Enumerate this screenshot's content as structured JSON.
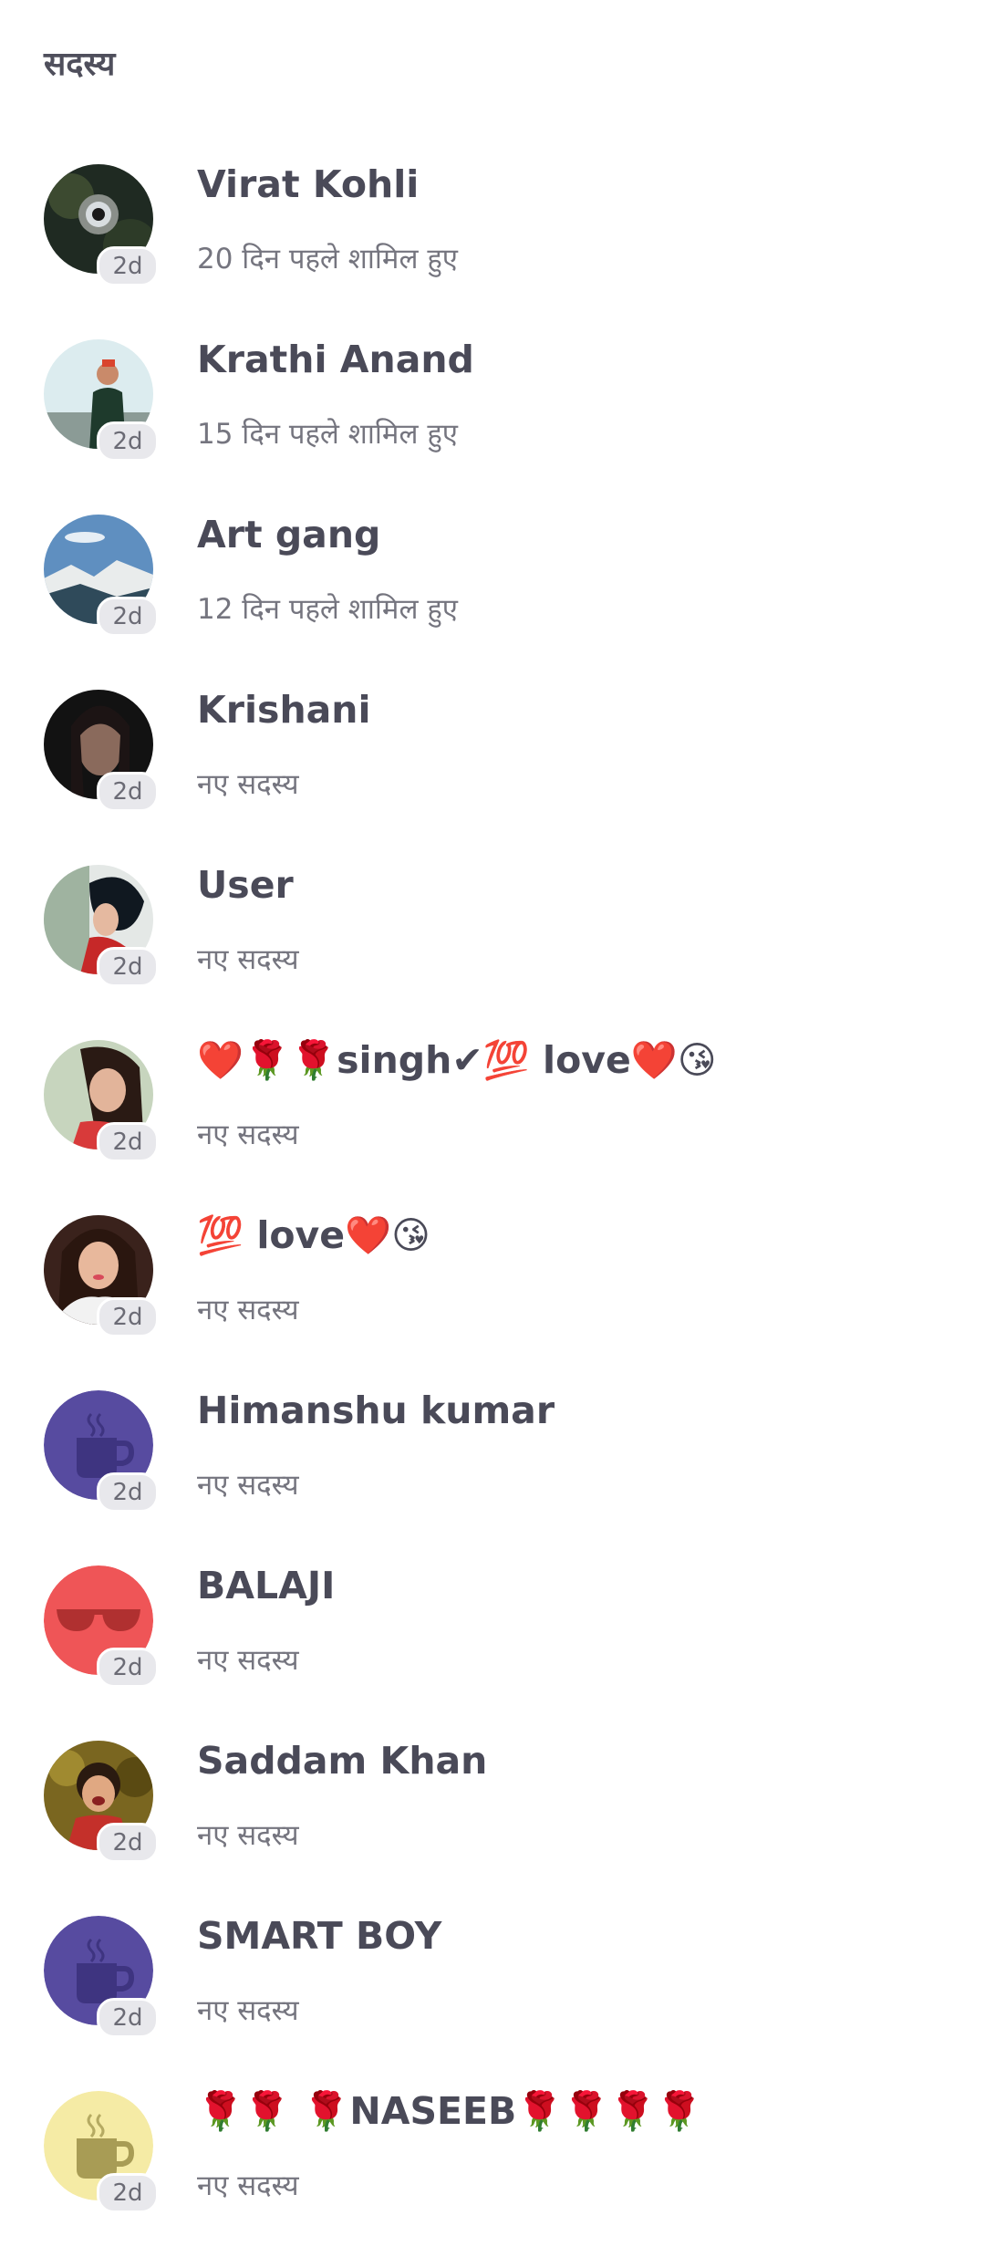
{
  "page": {
    "title": "सदस्य"
  },
  "members": [
    {
      "name": "Virat Kohli",
      "subtitle": "20 दिन पहले शामिल हुए",
      "badge": "2d",
      "avatar_icon": "photo-avatar-icon",
      "avatar_color": "#1f2a22"
    },
    {
      "name": "Krathi Anand",
      "subtitle": " 15 दिन पहले शामिल हुए",
      "badge": "2d",
      "avatar_icon": "photo-avatar-icon",
      "avatar_color": "#cfe6ec"
    },
    {
      "name": "Art gang",
      "subtitle": " 12 दिन पहले शामिल हुए",
      "badge": "2d",
      "avatar_icon": "photo-avatar-icon",
      "avatar_color": "#3d6a94"
    },
    {
      "name": "Krishani",
      "subtitle": "नए सदस्य",
      "badge": "2d",
      "avatar_icon": "photo-avatar-icon",
      "avatar_color": "#141414"
    },
    {
      "name": "User",
      "subtitle": "नए सदस्य",
      "badge": "2d",
      "avatar_icon": "photo-avatar-icon",
      "avatar_color": "#d9dfe0"
    },
    {
      "name": "❤️🌹🌹singh✔💯 love❤️😘",
      "subtitle": "नए सदस्य",
      "badge": "2d",
      "avatar_icon": "photo-avatar-icon",
      "avatar_color": "#b6c6ad"
    },
    {
      "name": "💯 love❤️😘",
      "subtitle": "नए सदस्य",
      "badge": "2d",
      "avatar_icon": "photo-avatar-icon",
      "avatar_color": "#3a221c"
    },
    {
      "name": "Himanshu kumar",
      "subtitle": "नए सदस्य",
      "badge": "2d",
      "avatar_icon": "tea-cup-icon",
      "avatar_color": "#574ba0"
    },
    {
      "name": "BALAJI",
      "subtitle": "नए सदस्य",
      "badge": "2d",
      "avatar_icon": "sunglasses-icon",
      "avatar_color": "#ef5557"
    },
    {
      "name": "Saddam Khan",
      "subtitle": "नए सदस्य",
      "badge": "2d",
      "avatar_icon": "photo-avatar-icon",
      "avatar_color": "#6e5a18"
    },
    {
      "name": "SMART BOY",
      "subtitle": "नए सदस्य",
      "badge": "2d",
      "avatar_icon": "tea-cup-icon",
      "avatar_color": "#574ba0"
    },
    {
      "name": "🌹🌹 🌹NASEEB🌹🌹🌹🌹",
      "subtitle": "नए सदस्य",
      "badge": "2d",
      "avatar_icon": "tea-cup-icon",
      "avatar_color": "#f5eba5"
    }
  ]
}
